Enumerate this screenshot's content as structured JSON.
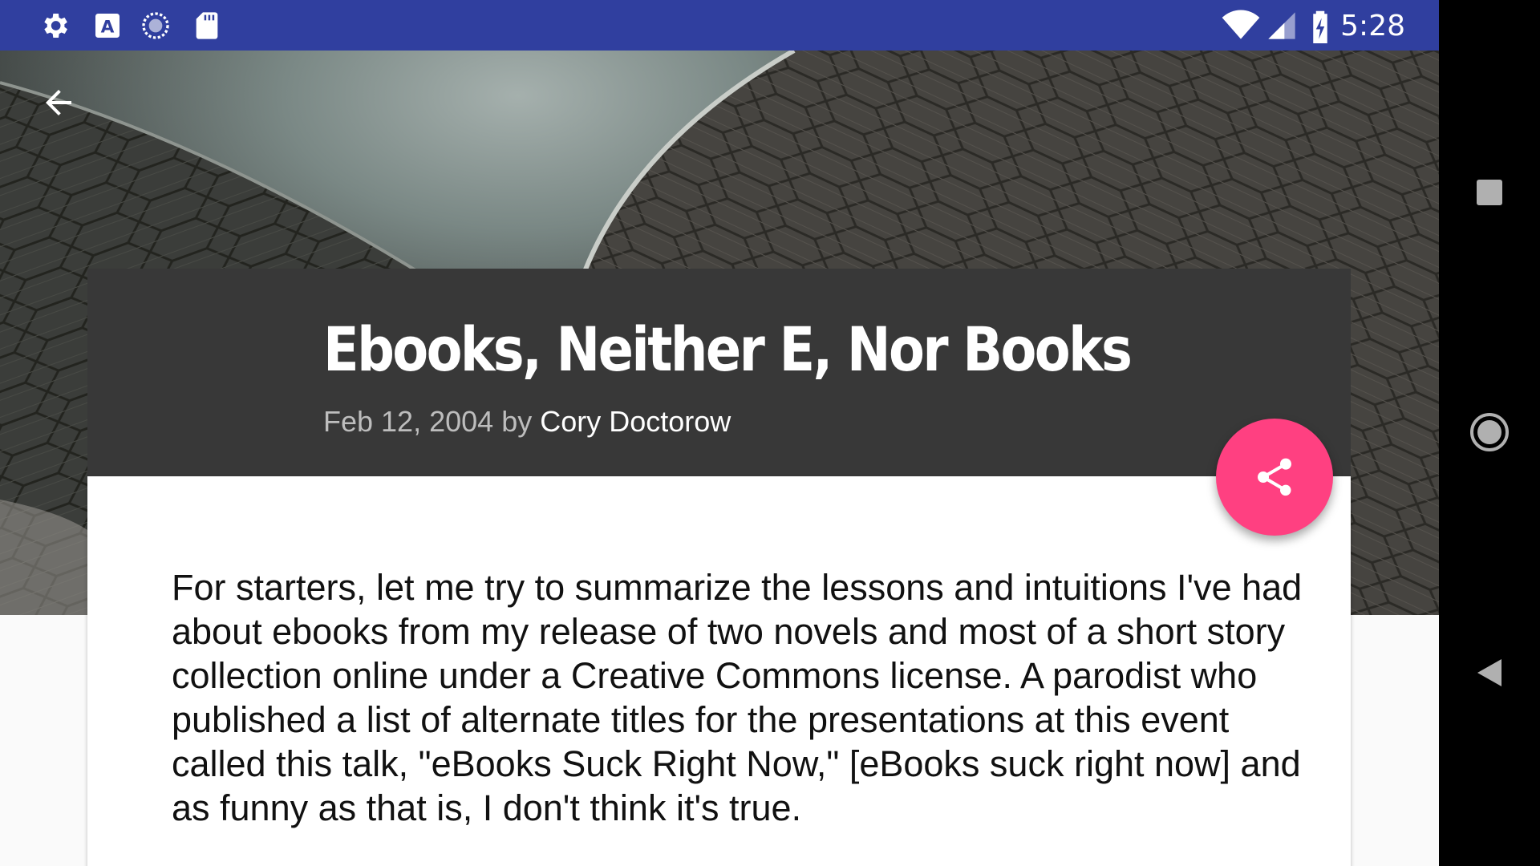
{
  "status_bar": {
    "time": "5:28",
    "left_icons": [
      "settings-icon",
      "font-a-icon",
      "sync-circle-icon",
      "sd-card-icon"
    ],
    "right_icons": [
      "wifi-icon",
      "cell-signal-icon",
      "battery-charging-icon"
    ],
    "background_color": "#303f9f"
  },
  "article": {
    "title": "Ebooks, Neither E, Nor Books",
    "date": "Feb 12, 2004",
    "by": "by",
    "author": "Cory Doctorow",
    "body": "For starters, let me try to summarize the lessons and intuitions I've had about ebooks from my release of two novels and most of a short story collection online under a Creative Commons license. A parodist who published a list of alternate titles for the presentations at this event called this talk, \"eBooks Suck Right Now,\" [eBooks suck right now] and as funny as that is, I don't think it's true."
  },
  "toolbar": {
    "back_icon": "arrow-back-icon"
  },
  "fab": {
    "icon": "share-icon",
    "color": "#ff4081"
  },
  "nav_bar": {
    "buttons": [
      "recents-square-icon",
      "home-circle-icon",
      "back-triangle-icon"
    ]
  }
}
